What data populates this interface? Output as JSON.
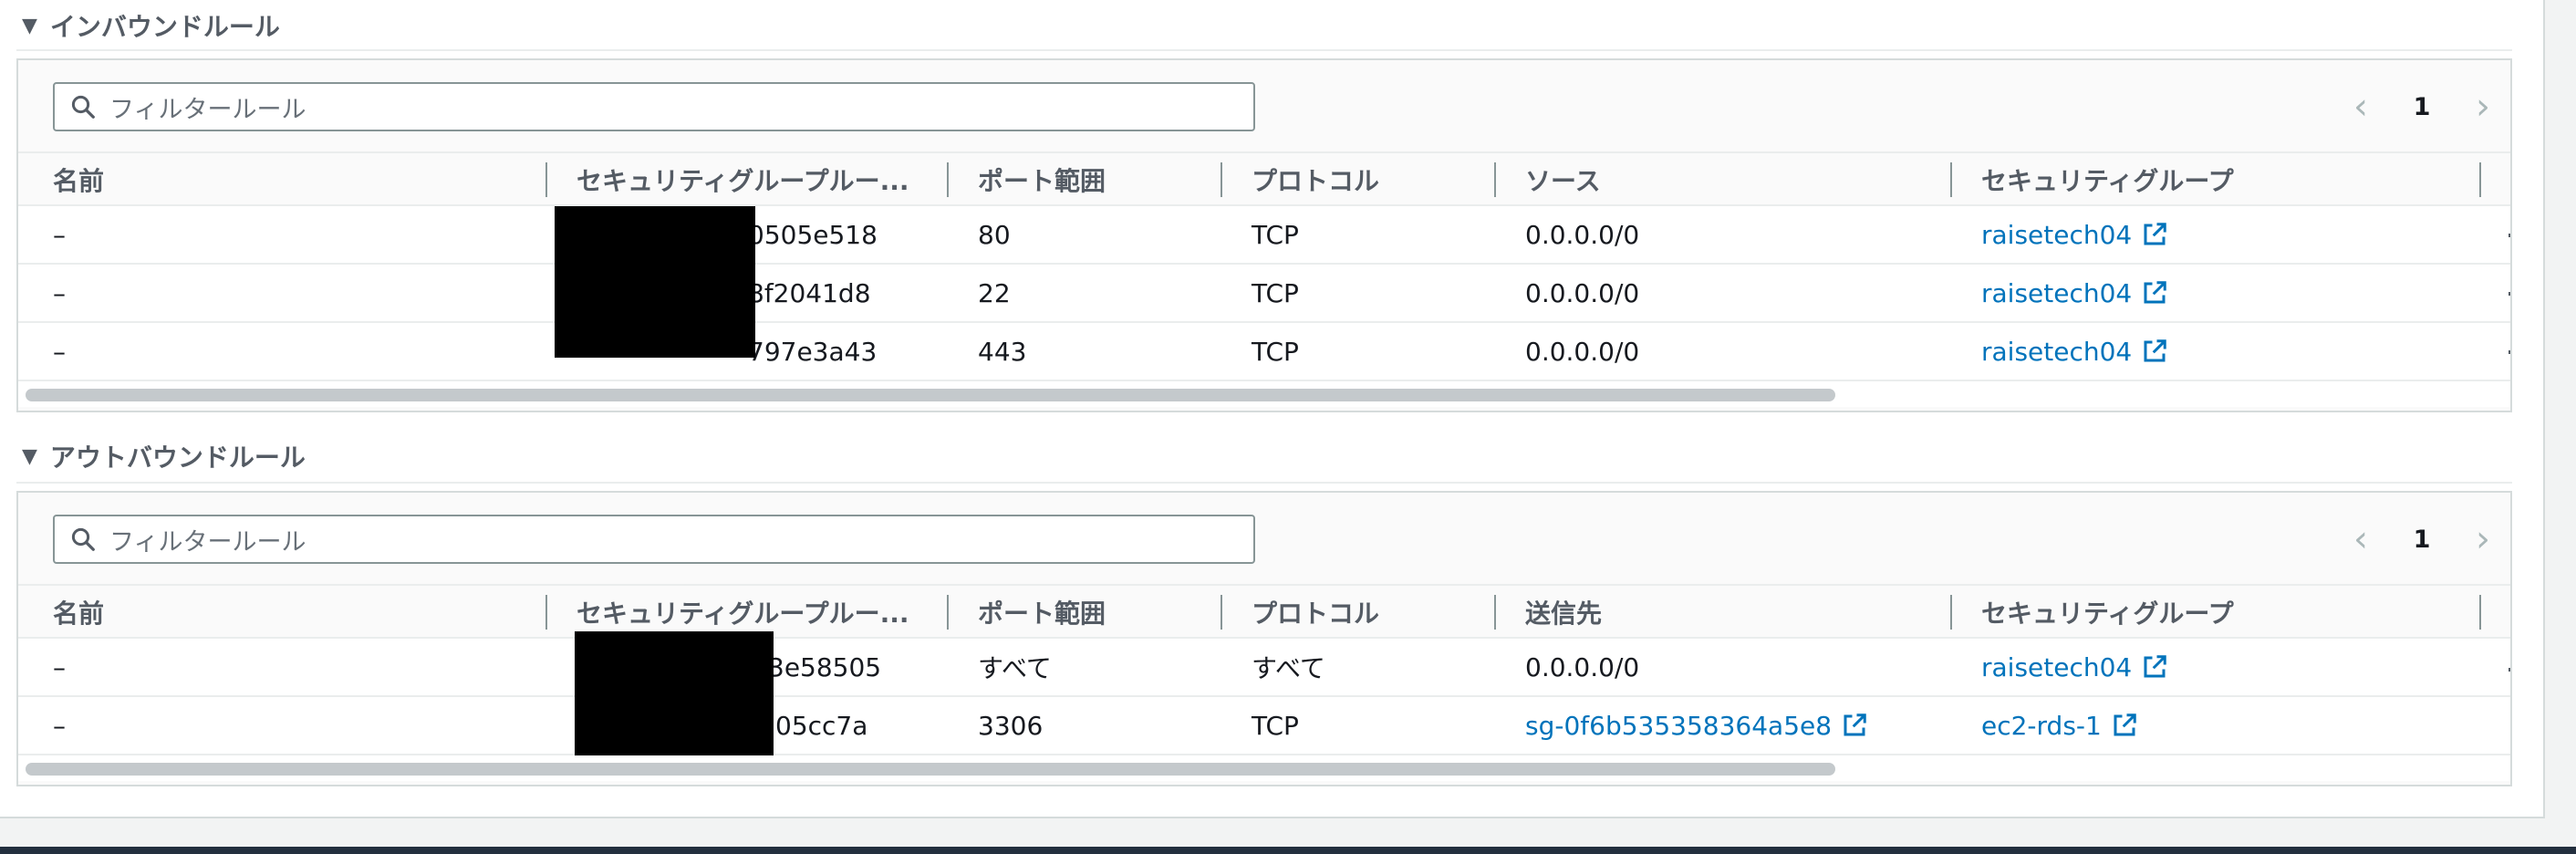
{
  "inbound": {
    "title": "インバウンドルール",
    "filter_placeholder": "フィルタールール",
    "page": "1",
    "columns": [
      "名前",
      "セキュリティグループルー...",
      "ポート範囲",
      "プロトコル",
      "ソース",
      "セキュリティグループ"
    ],
    "rows": [
      {
        "name": "–",
        "rule_id": "0505e518",
        "port": "80",
        "protocol": "TCP",
        "source": "0.0.0.0/0",
        "sg": "raisetech04"
      },
      {
        "name": "–",
        "rule_id": "8f2041d8",
        "port": "22",
        "protocol": "TCP",
        "source": "0.0.0.0/0",
        "sg": "raisetech04"
      },
      {
        "name": "–",
        "rule_id": "797e3a43",
        "port": "443",
        "protocol": "TCP",
        "source": "0.0.0.0/0",
        "sg": "raisetech04"
      }
    ]
  },
  "outbound": {
    "title": "アウトバウンドルール",
    "filter_placeholder": "フィルタールール",
    "page": "1",
    "columns": [
      "名前",
      "セキュリティグループルー...",
      "ポート範囲",
      "プロトコル",
      "送信先",
      "セキュリティグループ"
    ],
    "rows": [
      {
        "name": "–",
        "rule_id": "3e58505",
        "port": "すべて",
        "protocol": "すべて",
        "dest": "0.0.0.0/0",
        "sg": "raisetech04"
      },
      {
        "name": "–",
        "rule_id": "05cc7a",
        "port": "3306",
        "protocol": "TCP",
        "dest": "sg-0f6b535358364a5e8",
        "sg": "ec2-rds-1"
      }
    ]
  },
  "icons": {
    "search": "search-icon",
    "external_link": "external-link-icon",
    "caret": "caret-down-icon",
    "prev": "chevron-left-icon",
    "next": "chevron-right-icon"
  },
  "colors": {
    "link": "#0073bb",
    "header_text": "#545b64",
    "border": "#d5dbdb"
  }
}
